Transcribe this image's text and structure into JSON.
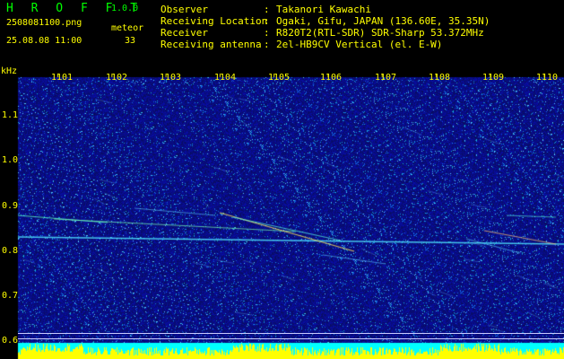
{
  "header": {
    "app_name": "H R O F F T",
    "version": "1.0.0",
    "filename": "2508081100.png",
    "datetime": "25.08.08 11:00",
    "count_label": "meteor",
    "count_value": "33",
    "info": [
      {
        "label": "Observer",
        "value": "Takanori Kawachi"
      },
      {
        "label": "Receiving Location",
        "value": "Ogaki, Gifu, JAPAN (136.60E, 35.35N)"
      },
      {
        "label": "Receiver",
        "value": "R820T2(RTL-SDR) SDR-Sharp 53.372MHz"
      },
      {
        "label": "Receiving antenna",
        "value": "2el-HB9CV Vertical (el. E-W)"
      }
    ],
    "separator": ":"
  },
  "spectrogram": {
    "unit_label": "kHz",
    "x_ticks": [
      "1101",
      "1102",
      "1103",
      "1104",
      "1105",
      "1106",
      "1107",
      "1108",
      "1109",
      "1110"
    ],
    "y_ticks": [
      "1.1",
      "1.0",
      "0.9",
      "0.8",
      "0.7",
      "0.6"
    ],
    "colors": {
      "background": "#000000",
      "noise_base": "#0a14a0",
      "label": "#ffff00",
      "power_bar": "#ffff00",
      "baseline": "#00ffff"
    }
  }
}
